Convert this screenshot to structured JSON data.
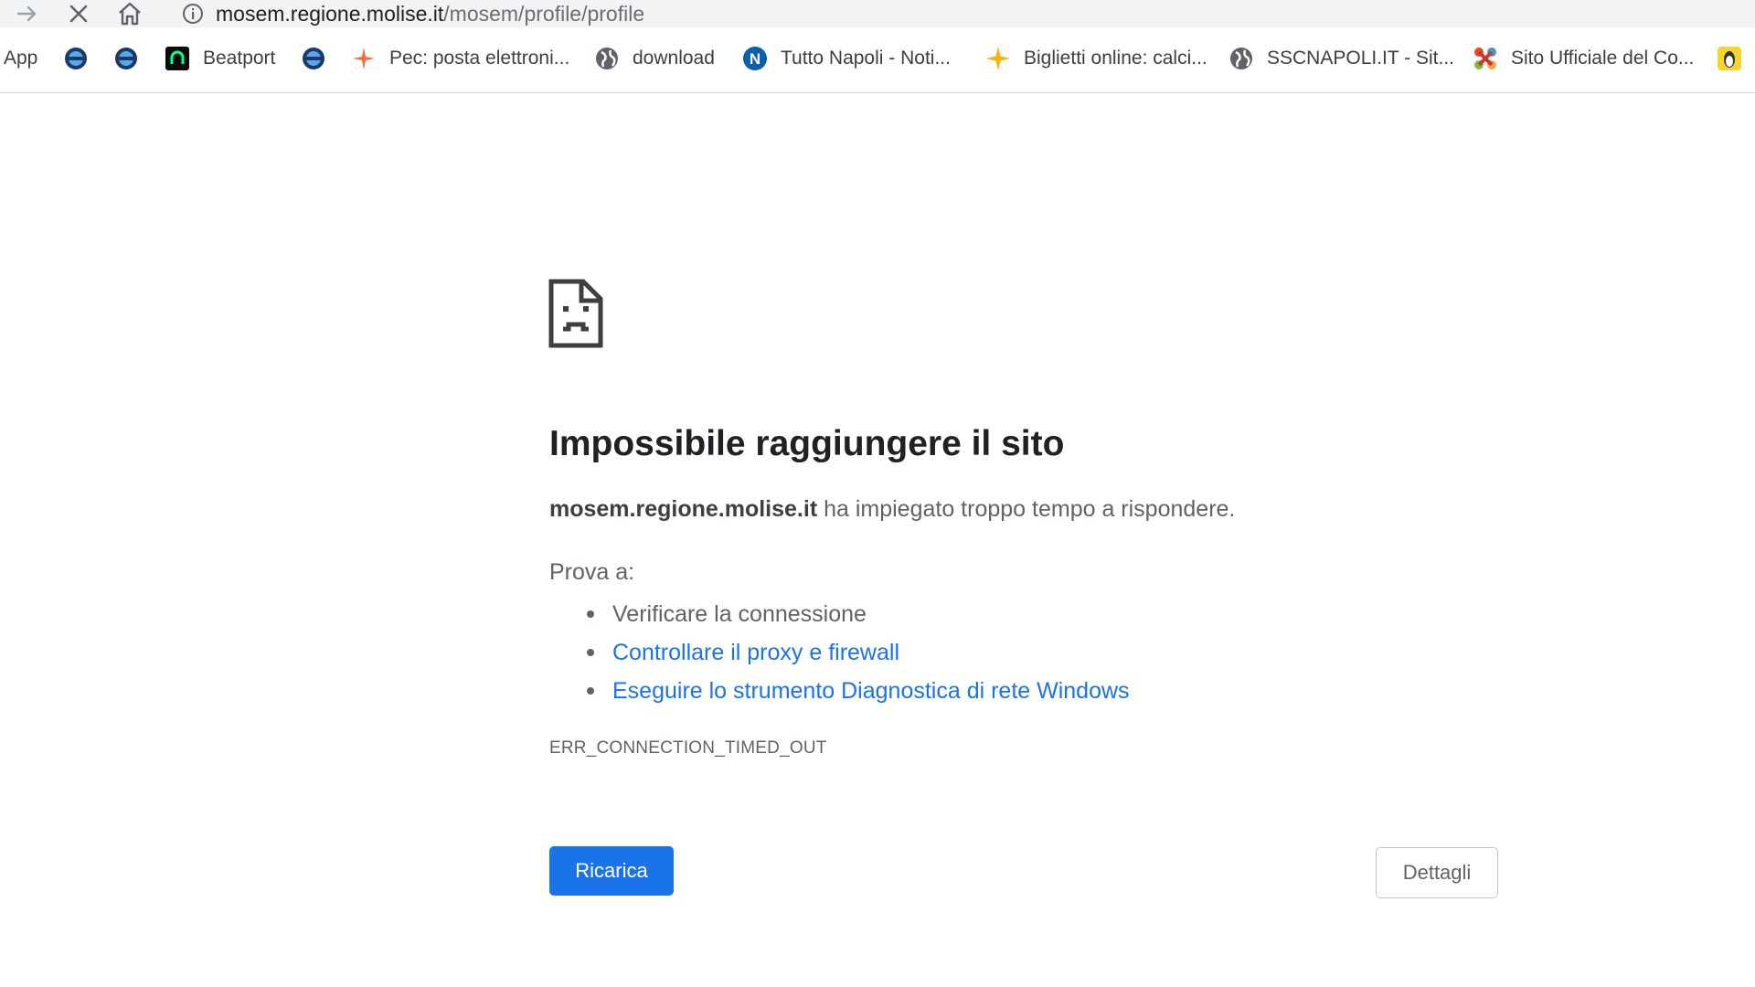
{
  "browser": {
    "url_host": "mosem.regione.molise.it",
    "url_path": "/mosem/profile/profile"
  },
  "bookmarks": {
    "apps_label": "App",
    "items": [
      {
        "label": "",
        "icon": "globe-blue-icon"
      },
      {
        "label": "",
        "icon": "globe-blue-icon"
      },
      {
        "label": "Beatport",
        "icon": "beatport-icon"
      },
      {
        "label": "",
        "icon": "globe-blue-icon"
      },
      {
        "label": "Pec: posta elettroni...",
        "icon": "pec-star-icon"
      },
      {
        "label": "download",
        "icon": "globe-icon"
      },
      {
        "label": "Tutto Napoli - Noti...",
        "icon": "tuttonapoli-icon"
      },
      {
        "label": "Biglietti online: calci...",
        "icon": "sparkle-icon"
      },
      {
        "label": "SSCNAPOLI.IT - Sit...",
        "icon": "globe-icon"
      },
      {
        "label": "Sito Ufficiale del Co...",
        "icon": "joomla-icon"
      },
      {
        "label": "",
        "icon": "linux-icon"
      }
    ]
  },
  "error": {
    "title": "Impossibile raggiungere il sito",
    "host": "mosem.regione.molise.it",
    "description_rest": " ha impiegato troppo tempo a rispondere.",
    "try_label": "Prova a:",
    "suggestions": [
      {
        "text": "Verificare la connessione",
        "link": false
      },
      {
        "text": "Controllare il proxy e firewall",
        "link": true
      },
      {
        "text": "Eseguire lo strumento Diagnostica di rete Windows",
        "link": true
      }
    ],
    "code": "ERR_CONNECTION_TIMED_OUT",
    "reload_label": "Ricarica",
    "details_label": "Dettagli"
  },
  "colors": {
    "accent": "#1a73e8",
    "toolbar": "#f1f3f4",
    "text_secondary": "#5f6368"
  }
}
